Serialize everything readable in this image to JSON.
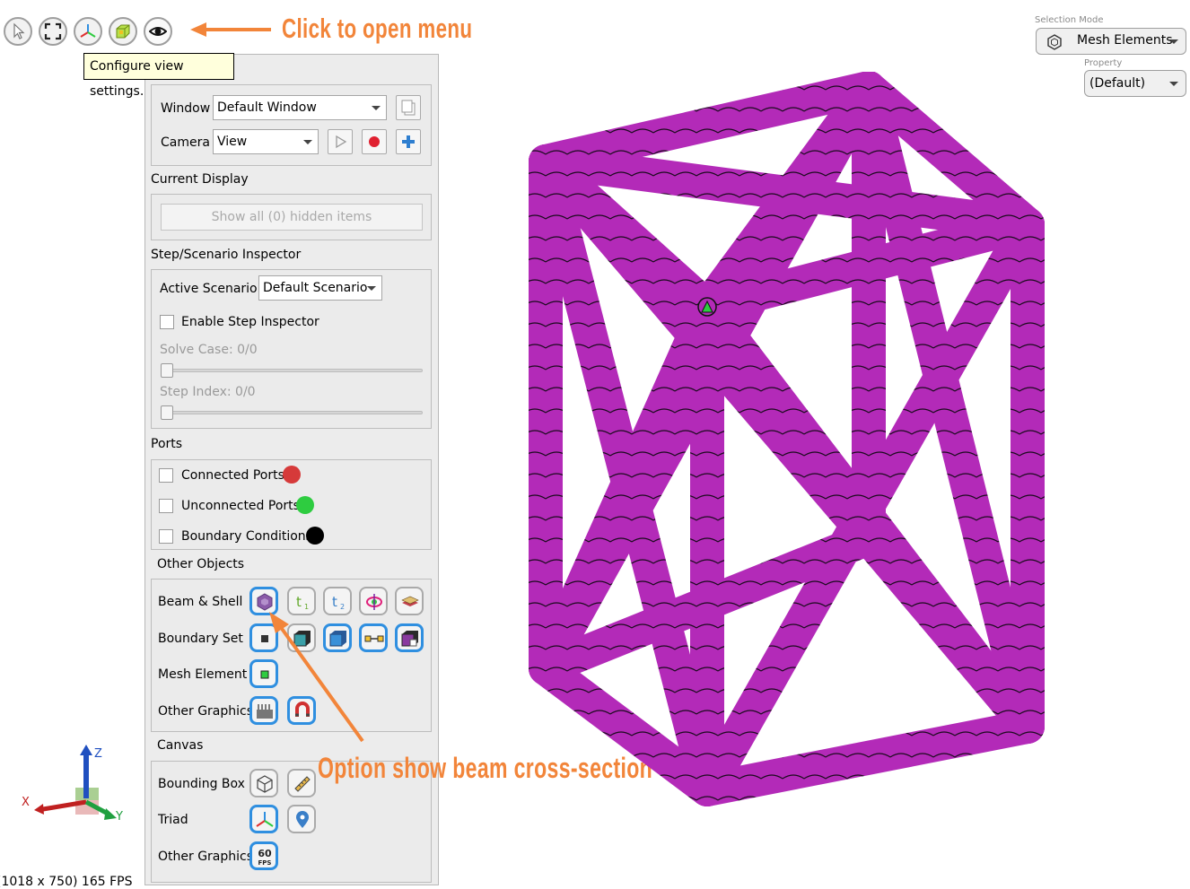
{
  "toolbar": {
    "buttons": [
      {
        "name": "select-cursor-icon"
      },
      {
        "name": "fit-view-icon"
      },
      {
        "name": "triad-view-icon"
      },
      {
        "name": "display-mode-icon"
      },
      {
        "name": "eye-view-settings-icon"
      }
    ],
    "tooltip": "Configure view settings.",
    "annotation_open_menu": "Click to open menu"
  },
  "panel": {
    "window": {
      "label": "Window",
      "value": "Default Window"
    },
    "camera": {
      "label": "Camera",
      "value": "View"
    },
    "current_display": {
      "title": "Current Display",
      "show_all_button": "Show all (0) hidden items"
    },
    "step_inspector": {
      "title": "Step/Scenario Inspector",
      "active_scenario_label": "Active Scenario:",
      "active_scenario_value": "Default Scenario",
      "enable_label": "Enable Step Inspector",
      "solve_case": "Solve Case: 0/0",
      "step_index": "Step Index: 0/0"
    },
    "ports": {
      "title": "Ports",
      "items": [
        {
          "label": "Connected Ports",
          "color": "#d63a3a"
        },
        {
          "label": "Unconnected Ports",
          "color": "#2ecc40"
        },
        {
          "label": "Boundary Conditions",
          "color": "#000000"
        }
      ]
    },
    "other_objects": {
      "title": "Other Objects",
      "rows": [
        "Beam & Shell",
        "Boundary Set",
        "Mesh Element",
        "Other Graphics"
      ]
    },
    "canvas": {
      "title": "Canvas",
      "rows": [
        "Bounding Box",
        "Triad",
        "Other Graphics"
      ],
      "fps_badge": "60",
      "fps_unit": "FPS"
    }
  },
  "annotation_beam": "Option show beam cross-section",
  "selection": {
    "mode_caption": "Selection Mode",
    "mode_value": "Mesh Elements",
    "property_caption": "Property",
    "property_value": "(Default)"
  },
  "triad": {
    "x": "X",
    "y": "Y",
    "z": "Z"
  },
  "status": "(1018 x 750) 165 FPS",
  "colors": {
    "accent": "#f2853a",
    "beam": "#b32ab8",
    "active_border": "#2f8fe0"
  }
}
